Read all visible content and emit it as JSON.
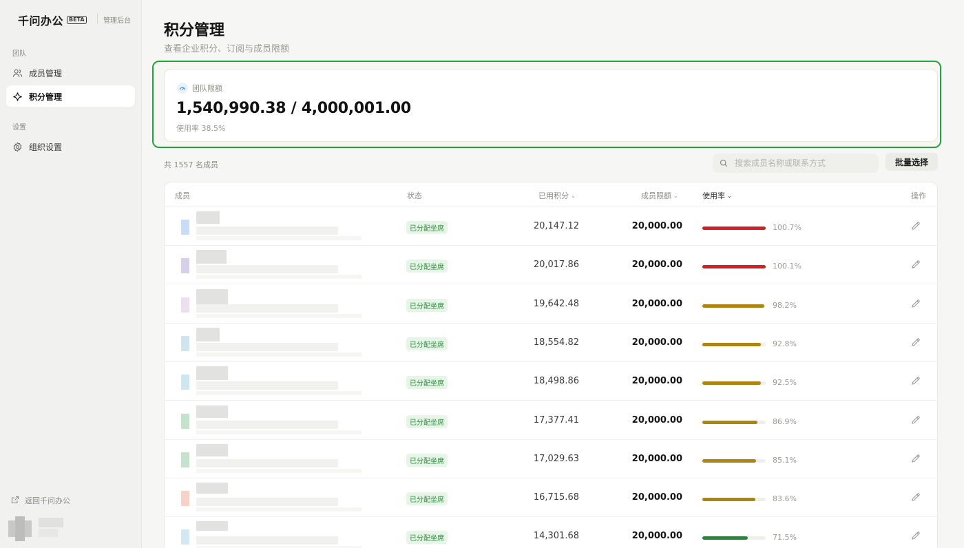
{
  "brand": {
    "name": "千问办公",
    "badge": "BETA",
    "subtitle": "管理后台"
  },
  "sidebar": {
    "sections": [
      {
        "label": "团队",
        "items": [
          {
            "label": "成员管理",
            "icon": "users-icon",
            "active": false
          },
          {
            "label": "积分管理",
            "icon": "sparkle-icon",
            "active": true
          }
        ]
      },
      {
        "label": "设置",
        "items": [
          {
            "label": "组织设置",
            "icon": "gear-icon",
            "active": false
          }
        ]
      }
    ],
    "footer_link": "返回千问办公"
  },
  "header": {
    "title": "积分管理",
    "subtitle": "查看企业积分、订阅与成员限额"
  },
  "quota": {
    "label": "团队限额",
    "value": "1,540,990.38 / 4,000,001.00",
    "usage_text": "使用率 38.5%",
    "usage_fraction": 0.385
  },
  "members": {
    "count_text": "共 1557 名成员",
    "search_placeholder": "搜索成员名称或联系方式",
    "batch_label": "批量选择"
  },
  "table": {
    "columns": {
      "member": "成员",
      "status": "状态",
      "used": "已用积分",
      "limit": "成员限额",
      "rate": "使用率",
      "action": "操作"
    },
    "colors": {
      "red": "#d42020",
      "amber": "#a8860f",
      "green": "#23883c"
    },
    "rows": [
      {
        "status": "已分配坐席",
        "used": "20,147.12",
        "limit": "20,000.00",
        "rate": "100.7%",
        "fraction": 1.0,
        "color": "red",
        "avatar": "#c9dcf5"
      },
      {
        "status": "已分配坐席",
        "used": "20,017.86",
        "limit": "20,000.00",
        "rate": "100.1%",
        "fraction": 1.0,
        "color": "red",
        "avatar": "#d6d0ea"
      },
      {
        "status": "已分配坐席",
        "used": "19,642.48",
        "limit": "20,000.00",
        "rate": "98.2%",
        "fraction": 0.982,
        "color": "amber",
        "avatar": "#ecdff0"
      },
      {
        "status": "已分配坐席",
        "used": "18,554.82",
        "limit": "20,000.00",
        "rate": "92.8%",
        "fraction": 0.928,
        "color": "amber",
        "avatar": "#cfe5ee"
      },
      {
        "status": "已分配坐席",
        "used": "18,498.86",
        "limit": "20,000.00",
        "rate": "92.5%",
        "fraction": 0.925,
        "color": "amber",
        "avatar": "#cfe6ef"
      },
      {
        "status": "已分配坐席",
        "used": "17,377.41",
        "limit": "20,000.00",
        "rate": "86.9%",
        "fraction": 0.869,
        "color": "amber",
        "avatar": "#c4e2cc"
      },
      {
        "status": "已分配坐席",
        "used": "17,029.63",
        "limit": "20,000.00",
        "rate": "85.1%",
        "fraction": 0.851,
        "color": "amber",
        "avatar": "#c4e2cc"
      },
      {
        "status": "已分配坐席",
        "used": "16,715.68",
        "limit": "20,000.00",
        "rate": "83.6%",
        "fraction": 0.836,
        "color": "amber",
        "avatar": "#f6d2c9"
      },
      {
        "status": "已分配坐席",
        "used": "14,301.68",
        "limit": "20,000.00",
        "rate": "71.5%",
        "fraction": 0.715,
        "color": "green",
        "avatar": "#d3e8f0"
      }
    ]
  }
}
